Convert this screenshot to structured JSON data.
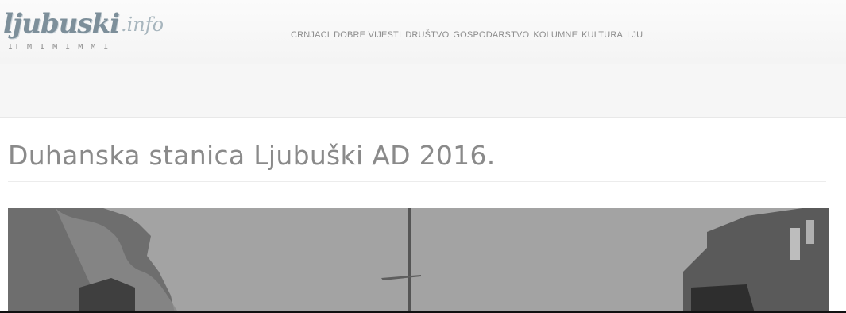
{
  "site": {
    "logo_text": "ljubuski",
    "logo_tld": ".info",
    "logo_tagline": "IT M I M I M M I"
  },
  "nav": {
    "items": [
      {
        "label": "CRNJACI"
      },
      {
        "label": "DOBRE VIJESTI"
      },
      {
        "label": "DRUŠTVO"
      },
      {
        "label": "GOSPODARSTVO"
      },
      {
        "label": "KOLUMNE"
      },
      {
        "label": "KULTURA"
      },
      {
        "label": "LJU"
      }
    ]
  },
  "article": {
    "title": "Duhanska stanica Ljubuški AD 2016."
  },
  "colors": {
    "nav_text": "#8d8d8d",
    "title_text": "#8a8a8a",
    "logo": "#7d8f9a",
    "header_bg": "#f6f6f6"
  }
}
